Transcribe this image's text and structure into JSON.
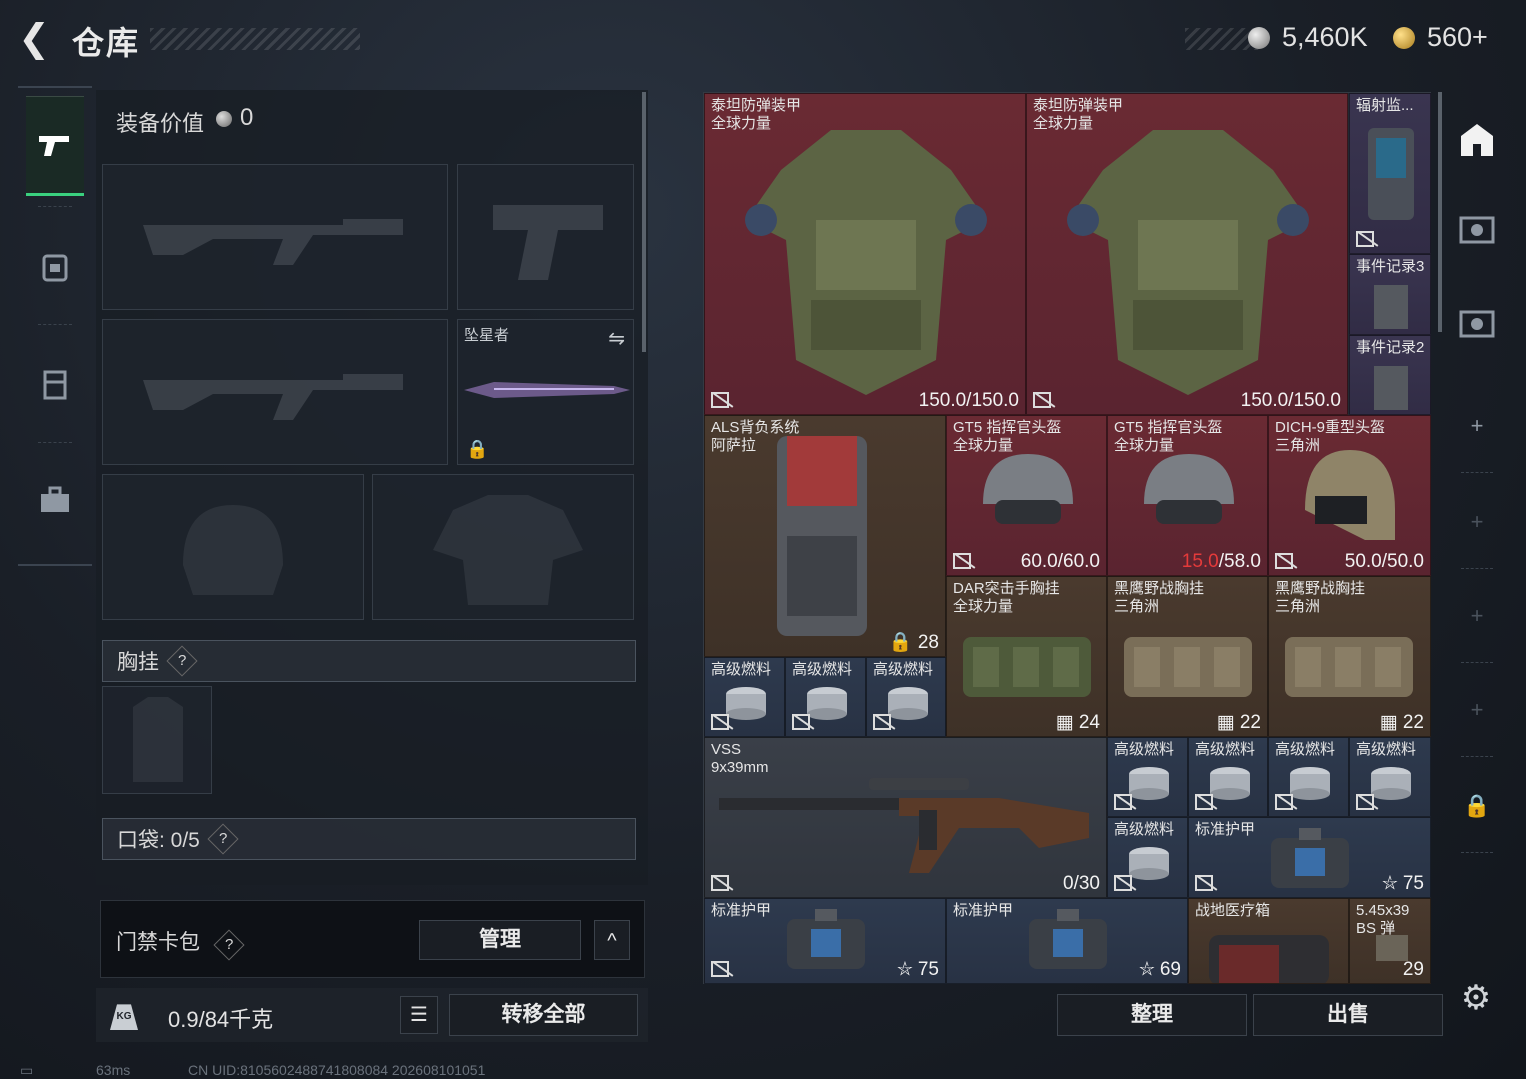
{
  "header": {
    "title": "仓库",
    "silver": "5,460K",
    "gold": "560+"
  },
  "equipment": {
    "value_label": "装备价值",
    "value": "0",
    "melee_name": "坠星者",
    "chest_rig_label": "胸挂",
    "pockets_label": "口袋: 0/5",
    "keycard_label": "门禁卡包",
    "manage_label": "管理",
    "weight": "0.9/84千克",
    "transfer_label": "转移全部"
  },
  "inventory": {
    "items": [
      {
        "name": "泰坦防弹装甲\n全球力量",
        "value": "150.0/150.0"
      },
      {
        "name": "泰坦防弹装甲\n全球力量",
        "value": "150.0/150.0"
      },
      {
        "name": "辐射监..."
      },
      {
        "name": "事件记录3"
      },
      {
        "name": "事件记录2"
      },
      {
        "name": "ALS背负系统\n阿萨拉",
        "value": "28"
      },
      {
        "name": "GT5 指挥官头盔\n全球力量",
        "value": "60.0/60.0"
      },
      {
        "name": "GT5 指挥官头盔\n全球力量",
        "value_warn": "15.0",
        "value_rest": "/58.0"
      },
      {
        "name": "DICH-9重型头盔\n三角洲",
        "value": "50.0/50.0"
      },
      {
        "name": "DAR突击手胸挂\n全球力量",
        "value": "24"
      },
      {
        "name": "黑鹰野战胸挂\n三角洲",
        "value": "22"
      },
      {
        "name": "黑鹰野战胸挂\n三角洲",
        "value": "22"
      },
      {
        "name": "高级燃料"
      },
      {
        "name": "VSS\n9x39mm",
        "value": "0/30"
      },
      {
        "name": "标准护甲",
        "value": "75"
      },
      {
        "name": "标准护甲",
        "value": "69"
      },
      {
        "name": "战地医疗箱"
      },
      {
        "name": "5.45x39\nBS 弹",
        "value": "29"
      }
    ]
  },
  "actions": {
    "sort": "整理",
    "sell": "出售"
  },
  "status": {
    "ping": "63ms",
    "uid": "CN UID:8105602488741808084 202608101051"
  }
}
